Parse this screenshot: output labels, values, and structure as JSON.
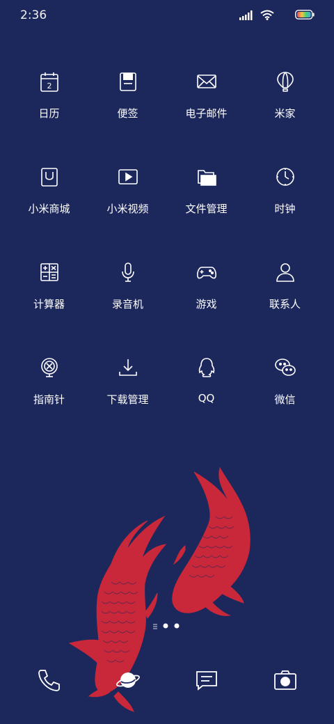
{
  "status_bar": {
    "time": "2:36",
    "icons": [
      "signal-icon",
      "wifi-icon",
      "battery-icon"
    ]
  },
  "apps": [
    {
      "label": "日历",
      "icon": "calendar-icon",
      "calendar_day": "2"
    },
    {
      "label": "便签",
      "icon": "notes-icon"
    },
    {
      "label": "电子邮件",
      "icon": "mail-icon"
    },
    {
      "label": "米家",
      "icon": "hot-air-balloon-icon"
    },
    {
      "label": "小米商城",
      "icon": "mi-store-bag-icon"
    },
    {
      "label": "小米视频",
      "icon": "video-play-icon"
    },
    {
      "label": "文件管理",
      "icon": "folder-icon"
    },
    {
      "label": "时钟",
      "icon": "clock-icon"
    },
    {
      "label": "计算器",
      "icon": "calculator-icon"
    },
    {
      "label": "录音机",
      "icon": "microphone-icon"
    },
    {
      "label": "游戏",
      "icon": "gamepad-icon"
    },
    {
      "label": "联系人",
      "icon": "contact-person-icon"
    },
    {
      "label": "指南针",
      "icon": "compass-icon"
    },
    {
      "label": "下载管理",
      "icon": "download-icon"
    },
    {
      "label": "QQ",
      "icon": "qq-penguin-icon"
    },
    {
      "label": "微信",
      "icon": "wechat-icon"
    }
  ],
  "pager": {
    "pages": 2,
    "current": 1
  },
  "dock": [
    "phone-icon",
    "browser-planet-icon",
    "messages-icon",
    "camera-icon"
  ],
  "colors": {
    "background": "#1c275c",
    "icon_stroke": "#ffffff",
    "koi_red": "#c8283a",
    "battery_gradient": [
      "#e84a5f",
      "#f4c542",
      "#4ad66d",
      "#4aa3f0"
    ]
  }
}
